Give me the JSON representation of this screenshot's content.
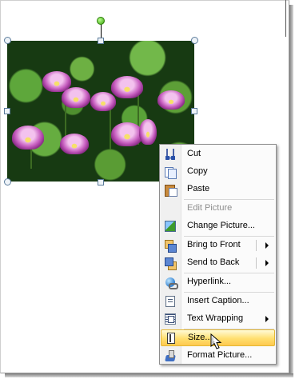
{
  "menu": {
    "items": [
      {
        "label": "Cut",
        "icon": "scissors-icon",
        "enabled": true
      },
      {
        "label": "Copy",
        "icon": "copy-icon",
        "enabled": true
      },
      {
        "label": "Paste",
        "icon": "paste-icon",
        "enabled": true
      },
      {
        "label": "Edit Picture",
        "icon": "",
        "enabled": false
      },
      {
        "label": "Change Picture...",
        "icon": "change-picture-icon",
        "enabled": true
      },
      {
        "label": "Bring to Front",
        "icon": "bring-to-front-icon",
        "enabled": true,
        "submenu": true
      },
      {
        "label": "Send to Back",
        "icon": "send-to-back-icon",
        "enabled": true,
        "submenu": true
      },
      {
        "label": "Hyperlink...",
        "icon": "hyperlink-icon",
        "enabled": true
      },
      {
        "label": "Insert Caption...",
        "icon": "caption-icon",
        "enabled": true
      },
      {
        "label": "Text Wrapping",
        "icon": "text-wrapping-icon",
        "enabled": true,
        "submenu": true
      },
      {
        "label": "Size...",
        "icon": "size-icon",
        "enabled": true,
        "highlighted": true
      },
      {
        "label": "Format Picture...",
        "icon": "format-picture-icon",
        "enabled": true
      }
    ]
  },
  "colors": {
    "highlight_top": "#fffbd8",
    "highlight_bottom": "#fec84e",
    "rotate_handle": "#3aa20d"
  }
}
